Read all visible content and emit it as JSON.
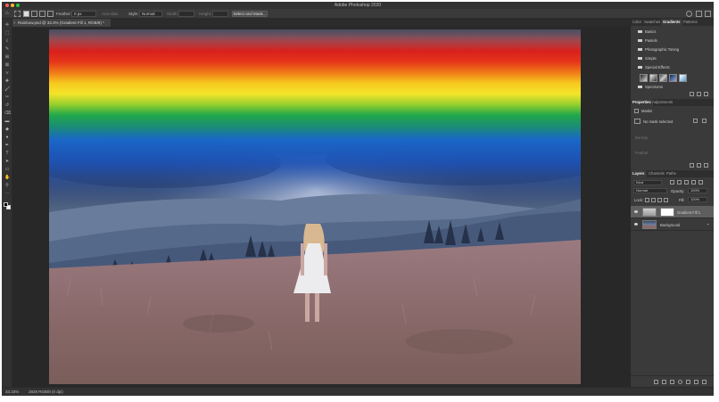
{
  "window": {
    "title": "Adobe Photoshop 2020",
    "traffic_colors": [
      "#ff5f57",
      "#febc2e",
      "#28c840"
    ]
  },
  "options_bar": {
    "feather_label": "Feather:",
    "feather_value": "0 px",
    "anti_alias_label": "Anti-alias",
    "style_label": "Style:",
    "style_value": "Normal",
    "width_label": "Width:",
    "height_label": "Height:",
    "select_mask_label": "Select and Mask..."
  },
  "document": {
    "tab_label": "Rainbow.psd @ 33.3% (Gradient Fill 1, RGB/8) *",
    "close_glyph": "×"
  },
  "toolbar": {
    "tools": [
      "move-tool-icon",
      "marquee-tool-icon",
      "lasso-tool-icon",
      "quick-select-tool-icon",
      "crop-tool-icon",
      "frame-tool-icon",
      "eyedropper-tool-icon",
      "healing-brush-tool-icon",
      "brush-tool-icon",
      "clone-stamp-tool-icon",
      "history-brush-tool-icon",
      "eraser-tool-icon",
      "gradient-tool-icon",
      "blur-tool-icon",
      "dodge-tool-icon",
      "pen-tool-icon",
      "type-tool-icon",
      "path-select-tool-icon",
      "rectangle-tool-icon",
      "hand-tool-icon",
      "zoom-tool-icon",
      "more-tools-icon"
    ]
  },
  "status_bar": {
    "zoom": "33.33%",
    "info": "2828 RGB/8 (0 dpi)"
  },
  "gradients_panel": {
    "tabs": [
      "Color",
      "Swatches",
      "Gradients",
      "Patterns"
    ],
    "active_tab": "Gradients",
    "folders": [
      "Basics",
      "Pastels",
      "Photographic Toning",
      "Simple",
      "Special Effects",
      "Spectrums"
    ]
  },
  "properties_panel": {
    "tabs": [
      "Properties",
      "Adjustments"
    ],
    "active_tab": "Properties",
    "section": "Masks",
    "no_mask_text": "No mask selected",
    "density_label": "Density:",
    "feather_label": "Feather:"
  },
  "layers_panel": {
    "tabs": [
      "Layers",
      "Channels",
      "Paths"
    ],
    "active_tab": "Layers",
    "filter_kind": "Kind",
    "blend_mode": "Normal",
    "opacity_label": "Opacity:",
    "opacity_value": "100%",
    "lock_label": "Lock:",
    "fill_label": "Fill:",
    "fill_value": "100%",
    "layers": [
      {
        "name": "Gradient Fill 1",
        "selected": true
      },
      {
        "name": "Background",
        "selected": false
      }
    ]
  },
  "colors": {
    "app_bg": "#535353",
    "panel_bg": "#3a3a3a",
    "selected_layer": "#5e5e5e",
    "rainbow": [
      "#cc1e1e",
      "#e0321a",
      "#f07a18",
      "#f8d020",
      "#9ad42a",
      "#1ea84a",
      "#1a66c8",
      "#1a3aa0"
    ]
  }
}
